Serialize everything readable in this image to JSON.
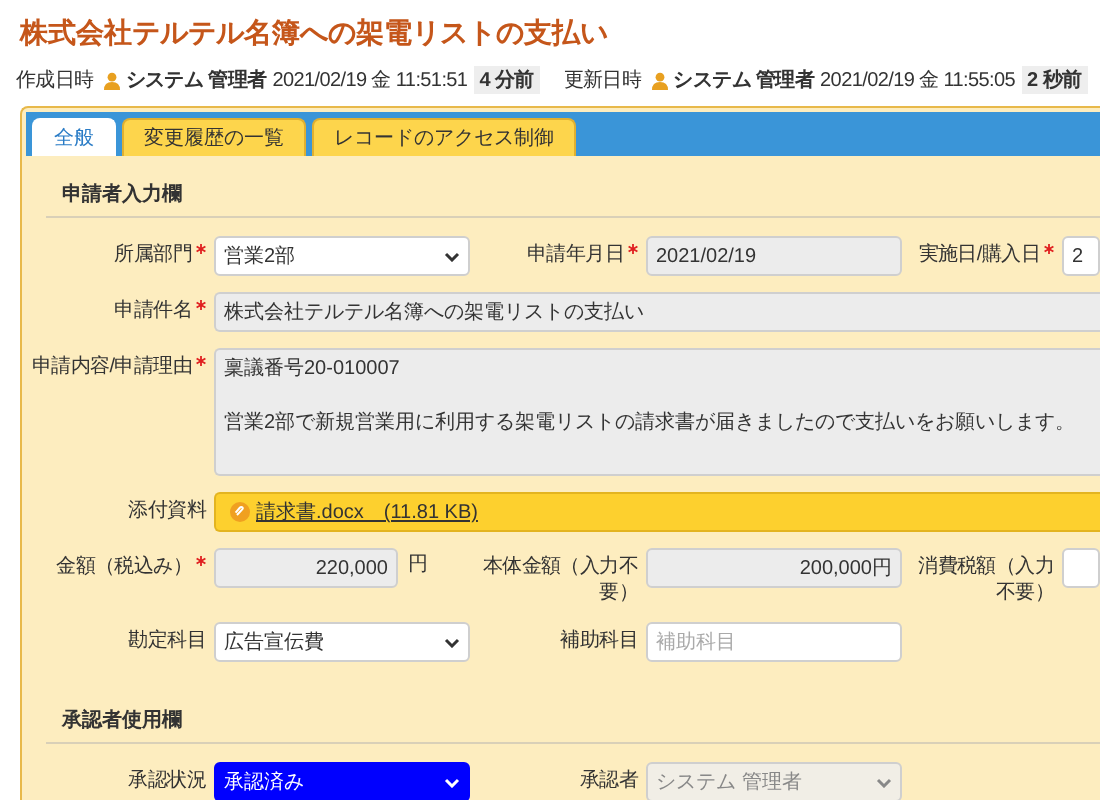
{
  "title": "株式会社テルテル名簿への架電リストの支払い",
  "meta": [
    {
      "label": "作成日時",
      "user": "システム 管理者",
      "datetime": "2021/02/19 金 11:51:51",
      "ago": "4 分前"
    },
    {
      "label": "更新日時",
      "user": "システム 管理者",
      "datetime": "2021/02/19 金 11:55:05",
      "ago": "2 秒前"
    }
  ],
  "tabs": [
    {
      "label": "全般",
      "selected": true
    },
    {
      "label": "変更履歴の一覧",
      "selected": false
    },
    {
      "label": "レコードのアクセス制御",
      "selected": false
    }
  ],
  "sections": [
    {
      "heading": "申請者入力欄",
      "rows": [
        [
          {
            "label": "所属部門",
            "required": true,
            "kind": "select",
            "value": "営業2部"
          },
          {
            "label": "申請年月日",
            "required": true,
            "kind": "text",
            "value": "2021/02/19",
            "readonly": true
          },
          {
            "label": "実施日/購入日",
            "required": true,
            "kind": "text",
            "value": "2",
            "readonly": false
          }
        ],
        [
          {
            "label": "申請件名",
            "required": true,
            "kind": "wide",
            "value": "株式会社テルテル名簿への架電リストの支払い",
            "readonly": true
          }
        ],
        [
          {
            "label": "申請内容/申請理由",
            "required": true,
            "kind": "textarea",
            "value": "稟議番号20-010007\n\n営業2部で新規営業用に利用する架電リストの請求書が届きましたので支払いをお願いします。",
            "readonly": true
          }
        ],
        [
          {
            "label": "添付資料",
            "required": false,
            "kind": "attachment",
            "value": "請求書.docx　(11.81 KB)"
          }
        ],
        [
          {
            "label": "金額（税込み）",
            "required": true,
            "kind": "amount",
            "value": "220,000",
            "unit": "円",
            "readonly": true
          },
          {
            "label": "本体金額（入力不要）",
            "required": false,
            "kind": "number",
            "value": "200,000円",
            "readonly": true
          },
          {
            "label": "消費税額（入力不要）",
            "required": false,
            "kind": "text",
            "readonly": false
          }
        ],
        [
          {
            "label": "勘定科目",
            "required": false,
            "kind": "select",
            "value": "広告宣伝費"
          },
          {
            "label": "補助科目",
            "required": false,
            "kind": "text",
            "placeholder": "補助科目",
            "readonly": false
          }
        ]
      ]
    },
    {
      "heading": "承認者使用欄",
      "rows": [
        [
          {
            "label": "承認状況",
            "required": false,
            "kind": "select",
            "value": "承認済み",
            "highlighted": true
          },
          {
            "label": "承認者",
            "required": false,
            "kind": "select",
            "value": "システム 管理者",
            "disabled": true
          }
        ]
      ]
    }
  ]
}
